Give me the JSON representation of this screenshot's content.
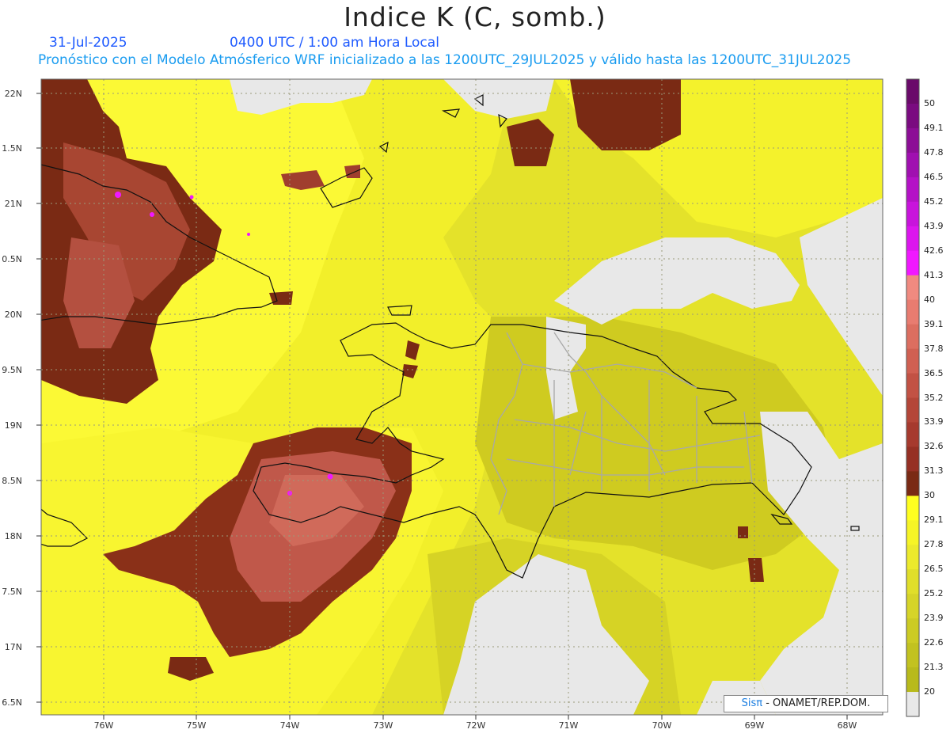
{
  "title": "Indice K (C, somb.)",
  "header": {
    "date": "31-Jul-2025",
    "time": "0400 UTC / 1:00 am Hora Local",
    "forecast": "Pronóstico con el Modelo Atmósferico WRF inicializado a las 1200UTC_29JUL2025 y válido hasta las  1200UTC_31JUL2025"
  },
  "map": {
    "lat_ticks": [
      "22N",
      "1.5N",
      "21N",
      "0.5N",
      "20N",
      "9.5N",
      "19N",
      "8.5N",
      "18N",
      "7.5N",
      "17N",
      "6.5N"
    ],
    "lon_ticks": [
      "76W",
      "75W",
      "74W",
      "73W",
      "72W",
      "71W",
      "70W",
      "69W",
      "68W"
    ]
  },
  "colorbar": {
    "labels": [
      "50",
      "49.1",
      "47.8",
      "46.5",
      "45.2",
      "43.9",
      "42.6",
      "41.3",
      "40",
      "39.1",
      "37.8",
      "36.5",
      "35.2",
      "33.9",
      "32.6",
      "31.3",
      "30",
      "29.1",
      "27.8",
      "26.5",
      "25.2",
      "23.9",
      "22.6",
      "21.3",
      "20"
    ],
    "colors": [
      "#6a0a6a",
      "#7a0b80",
      "#8c0e96",
      "#a010b0",
      "#b412c6",
      "#c814dc",
      "#dc16ee",
      "#f018ff",
      "#f08a80",
      "#e87c70",
      "#dc6e60",
      "#d06052",
      "#c25244",
      "#b44638",
      "#a63a2e",
      "#963024",
      "#7a2a14",
      "#ffff20",
      "#f6f426",
      "#ecea2c",
      "#e0de2a",
      "#d6d428",
      "#cccb24",
      "#c2c220",
      "#b8ba1c",
      "#e8e8e8"
    ]
  },
  "credit": {
    "sis": "Sisπ",
    "rest": " - ONAMET/REP.DOM."
  }
}
